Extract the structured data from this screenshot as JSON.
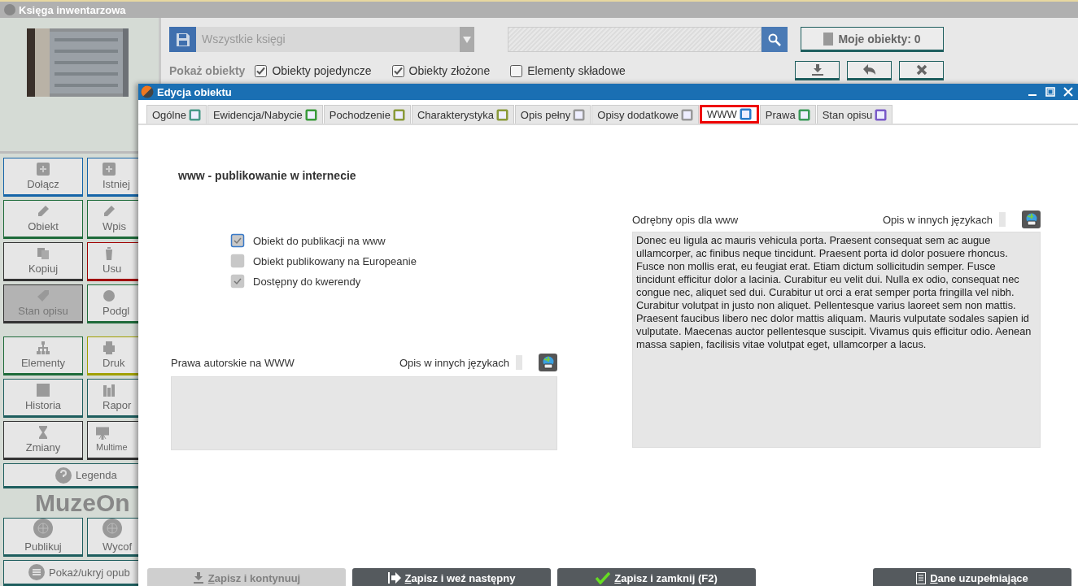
{
  "app": {
    "title": "Księga inwentarzowa"
  },
  "sidebar": {
    "groups": [
      [
        {
          "label": "Dołącz",
          "color": "#1565a8",
          "selected": false
        },
        {
          "label": "Istniej",
          "color": "#1565a8",
          "selected": false
        },
        {
          "label": "Obiekt",
          "color": "#1e6b3a",
          "selected": false
        },
        {
          "label": "Wpis",
          "color": "#1e6b3a",
          "selected": false
        },
        {
          "label": "Kopiuj",
          "color": "#333333",
          "selected": false
        },
        {
          "label": "Usu",
          "color": "#a00000",
          "selected": false
        },
        {
          "label": "Stan opisu",
          "color": "#333333",
          "selected": true
        },
        {
          "label": "Podgl",
          "color": "#1e6b3a",
          "selected": false
        }
      ],
      [
        {
          "label": "Elementy",
          "color": "#1e6b3a",
          "selected": false
        },
        {
          "label": "Druk",
          "color": "#a0a000",
          "selected": false
        },
        {
          "label": "Historia",
          "color": "#1e5e5e",
          "selected": false
        },
        {
          "label": "Rapor",
          "color": "#1e5e5e",
          "selected": false
        },
        {
          "label": "Zmiany",
          "color": "#333333",
          "selected": false
        },
        {
          "label": "Multime",
          "color": "#333333",
          "selected": false
        }
      ]
    ],
    "legend": "Legenda",
    "brand": "MuzeOn",
    "publish": [
      {
        "label": "Publikuj",
        "color": "#1e5e5e",
        "selected": false
      },
      {
        "label": "Wycof",
        "color": "#1e5e5e",
        "selected": false
      }
    ],
    "toggle": "Pokaż/ukryj opub"
  },
  "toolbar": {
    "book_select": {
      "value": "Wszystkie księgi"
    },
    "my_objects": "Moje obiekty: 0",
    "show_label": "Pokaż obiekty",
    "filters": [
      {
        "label": "Obiekty pojedyncze",
        "checked": true
      },
      {
        "label": "Obiekty złożone",
        "checked": true
      },
      {
        "label": "Elementy składowe",
        "checked": false
      }
    ]
  },
  "dialog": {
    "title": "Edycja obiektu",
    "tabs": [
      {
        "label": "Ogólne",
        "selected": false
      },
      {
        "label": "Ewidencja/Nabycie",
        "selected": false
      },
      {
        "label": "Pochodzenie",
        "selected": false
      },
      {
        "label": "Charakterystyka",
        "selected": false
      },
      {
        "label": "Opis pełny",
        "selected": false
      },
      {
        "label": "Opisy dodatkowe",
        "selected": false
      },
      {
        "label": "WWW",
        "selected": true
      },
      {
        "label": "Prawa",
        "selected": false
      },
      {
        "label": "Stan opisu",
        "selected": false
      }
    ],
    "heading": "www - publikowanie w internecie",
    "options": [
      {
        "label": "Obiekt do publikacji na www",
        "checked": true,
        "focused": true
      },
      {
        "label": "Obiekt publikowany na Europeanie",
        "checked": false,
        "focused": false
      },
      {
        "label": "Dostępny do kwerendy",
        "checked": true,
        "focused": false
      }
    ],
    "copyright": {
      "label": "Prawa autorskie na WWW",
      "languages_label": "Opis w innych językach"
    },
    "web_description": {
      "label": "Odrębny opis dla www",
      "languages_label": "Opis w innych językach",
      "value": "Donec eu ligula ac mauris vehicula porta. Praesent consequat sem ac augue ullamcorper, ac finibus neque tincidunt. Praesent porta id dolor posuere rhoncus. Fusce non mollis erat, eu feugiat erat. Etiam dictum sollicitudin semper. Fusce tincidunt efficitur dolor a lacinia. Curabitur eu velit dui. Nulla ex odio, consequat nec congue nec, aliquet sed dui. Curabitur ut orci a erat semper porta fringilla vel nibh. Curabitur volutpat in justo non aliquet. Pellentesque varius laoreet sem non mattis. Praesent faucibus libero nec dolor mattis aliquam. Mauris vulputate sodales sapien id vulputate. Maecenas auctor pellentesque suscipit. Vivamus quis efficitur odio. Aenean massa sapien, facilisis vitae volutpat eget, ullamcorper a lacus."
    },
    "footer": [
      {
        "label": "Zapisz i kontynuuj",
        "kind": "save",
        "disabled": true
      },
      {
        "label": "Zapisz i weź następny",
        "kind": "next",
        "disabled": false
      },
      {
        "label": "Zapisz i zamknij (F2)",
        "kind": "close",
        "disabled": false
      },
      {
        "label": "Dane uzupełniające",
        "kind": "extra",
        "disabled": false
      }
    ]
  }
}
